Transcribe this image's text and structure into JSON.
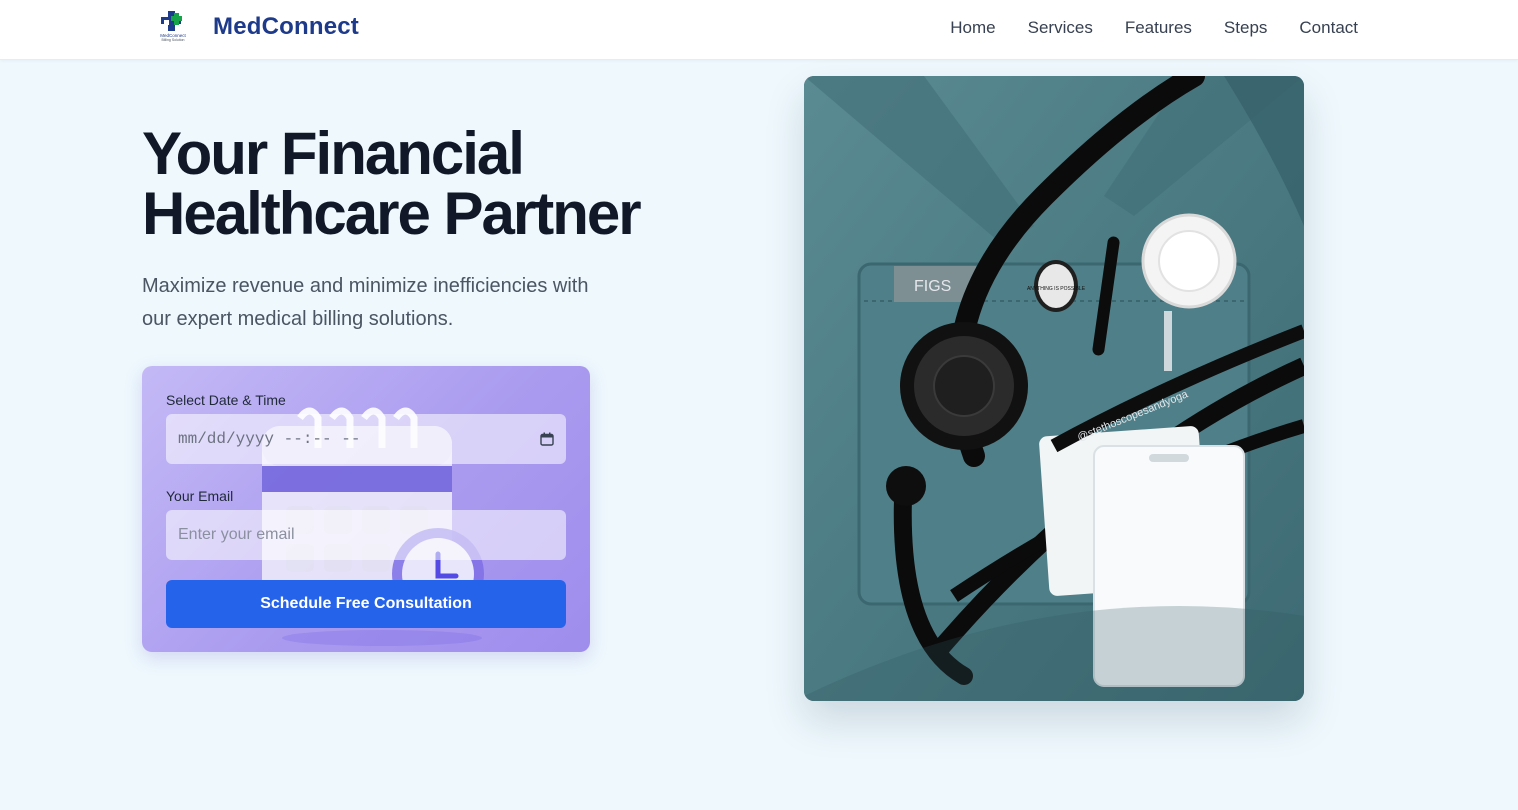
{
  "header": {
    "brand": "MedConnect",
    "logo_text": "MedConnect",
    "logo_tagline": "Billing Solution",
    "logo_icon": "medical-cross-logo-icon",
    "nav": [
      {
        "label": "Home"
      },
      {
        "label": "Services"
      },
      {
        "label": "Features"
      },
      {
        "label": "Steps"
      },
      {
        "label": "Contact"
      }
    ]
  },
  "hero": {
    "title_line1": "Your Financial",
    "title_line2": "Healthcare Partner",
    "subtitle_line1": "Maximize revenue and minimize inefficiencies with",
    "subtitle_line2": "our expert medical billing solutions."
  },
  "form": {
    "datetime_label": "Select Date & Time",
    "datetime_placeholder": "mm/dd/yyyy --:-- --",
    "email_label": "Your Email",
    "email_placeholder": "Enter your email",
    "submit_label": "Schedule Free Consultation",
    "calendar_icon": "calendar-icon"
  },
  "photo": {
    "pocket_tag": "FIGS",
    "strap_text": "@stethoscopesandyoga",
    "pin_text": "ANYTHING IS POSSIBLE"
  },
  "colors": {
    "brand": "#1e3a8a",
    "accent": "#2563eb",
    "background": "#eef8fd",
    "card_gradient_start": "#c4b9f6",
    "card_gradient_end": "#9f8ded"
  }
}
